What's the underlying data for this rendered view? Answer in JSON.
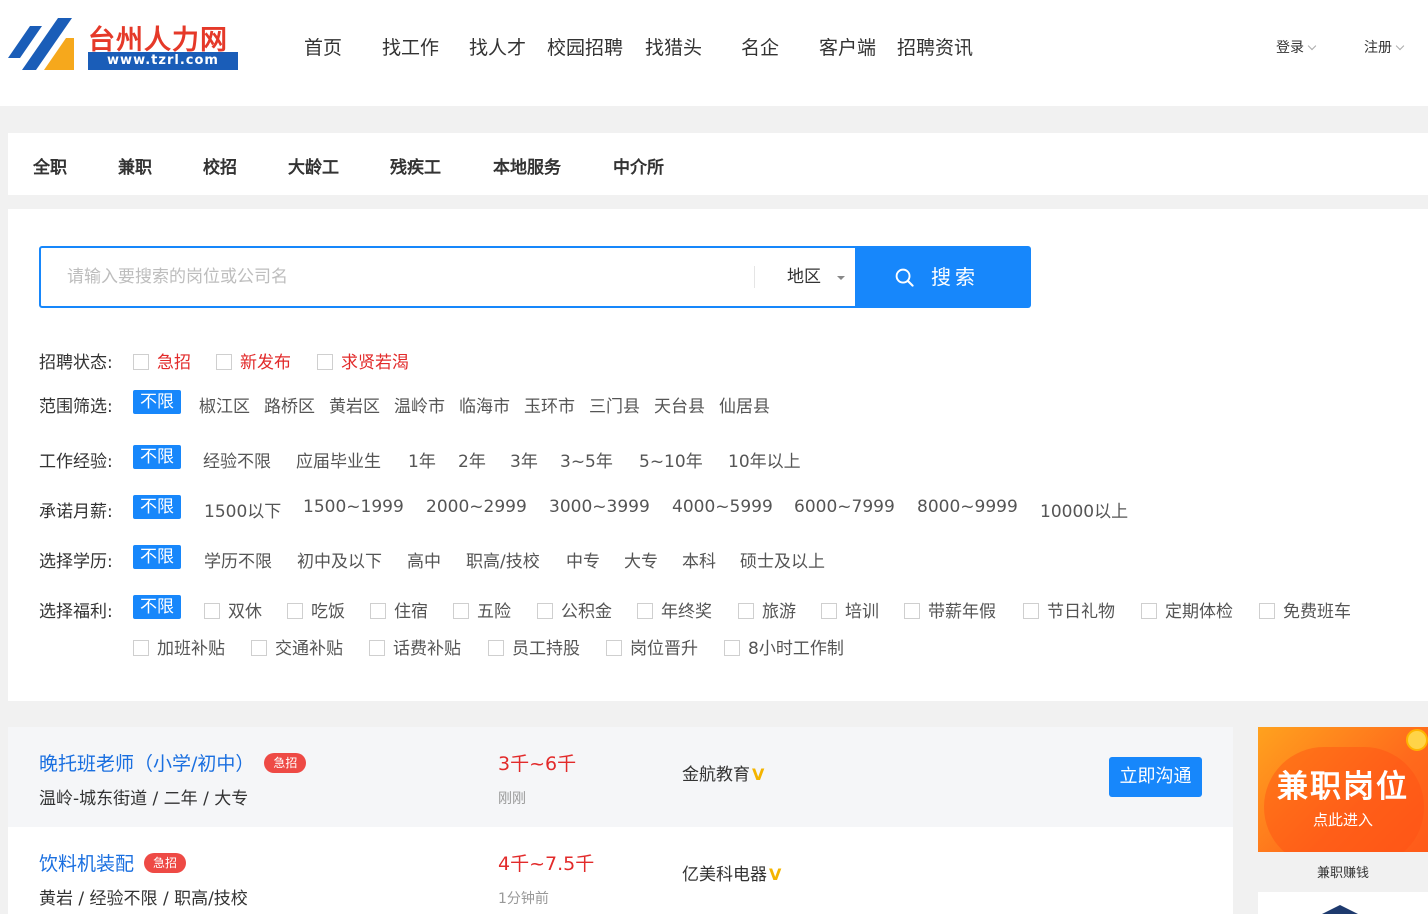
{
  "header": {
    "logo": {
      "name": "台州人力网",
      "url": "www.tzrl.com"
    },
    "nav": [
      "首页",
      "找工作",
      "找人才",
      "校园招聘",
      "找猎头",
      "名企",
      "客户端",
      "招聘资讯"
    ],
    "login_label": "登录",
    "register_label": "注册"
  },
  "category_tabs": [
    "全职",
    "兼职",
    "校招",
    "大龄工",
    "残疾工",
    "本地服务",
    "中介所"
  ],
  "search": {
    "placeholder": "请输入要搜索的岗位或公司名",
    "region_label": "地区",
    "button_label": "搜索"
  },
  "filters": {
    "status": {
      "label": "招聘状态:",
      "options": [
        "急招",
        "新发布",
        "求贤若渴"
      ]
    },
    "area": {
      "label": "范围筛选:",
      "selected": "不限",
      "options": [
        "椒江区",
        "路桥区",
        "黄岩区",
        "温岭市",
        "临海市",
        "玉环市",
        "三门县",
        "天台县",
        "仙居县"
      ]
    },
    "experience": {
      "label": "工作经验:",
      "selected": "不限",
      "options": [
        "经验不限",
        "应届毕业生",
        "1年",
        "2年",
        "3年",
        "3~5年",
        "5~10年",
        "10年以上"
      ]
    },
    "salary": {
      "label": "承诺月薪:",
      "selected": "不限",
      "options": [
        "1500以下",
        "1500~1999",
        "2000~2999",
        "3000~3999",
        "4000~5999",
        "6000~7999",
        "8000~9999",
        "10000以上"
      ]
    },
    "education": {
      "label": "选择学历:",
      "selected": "不限",
      "options": [
        "学历不限",
        "初中及以下",
        "高中",
        "职高/技校",
        "中专",
        "大专",
        "本科",
        "硕士及以上"
      ]
    },
    "benefits": {
      "label": "选择福利:",
      "selected": "不限",
      "options": [
        "双休",
        "吃饭",
        "住宿",
        "五险",
        "公积金",
        "年终奖",
        "旅游",
        "培训",
        "带薪年假",
        "节日礼物",
        "定期体检",
        "免费班车",
        "加班补贴",
        "交通补贴",
        "话费补贴",
        "员工持股",
        "岗位晋升",
        "8小时工作制"
      ]
    }
  },
  "jobs": [
    {
      "title": "晚托班老师（小学/初中）",
      "badge": "急招",
      "meta": "温岭-城东街道 / 二年 / 大专",
      "salary": "3千~6千",
      "posted": "刚刚",
      "company": "金航教育",
      "verified": "V",
      "action": "立即沟通"
    },
    {
      "title": "饮料机装配",
      "badge": "急招",
      "meta": "黄岩 / 经验不限 / 职高/技校",
      "salary": "4千~7.5千",
      "posted": "1分钟前",
      "company": "亿美科电器",
      "verified": "V",
      "action": ""
    }
  ],
  "side_banner": {
    "title": "兼职岗位",
    "subtitle": "点此进入",
    "caption": "兼职赚钱"
  },
  "colors": {
    "brand_blue": "#1787fb",
    "accent_red": "#e22a2a",
    "logo_red": "#e53929",
    "logo_blue": "#1a5db8",
    "verified_gold": "#f4b400"
  }
}
